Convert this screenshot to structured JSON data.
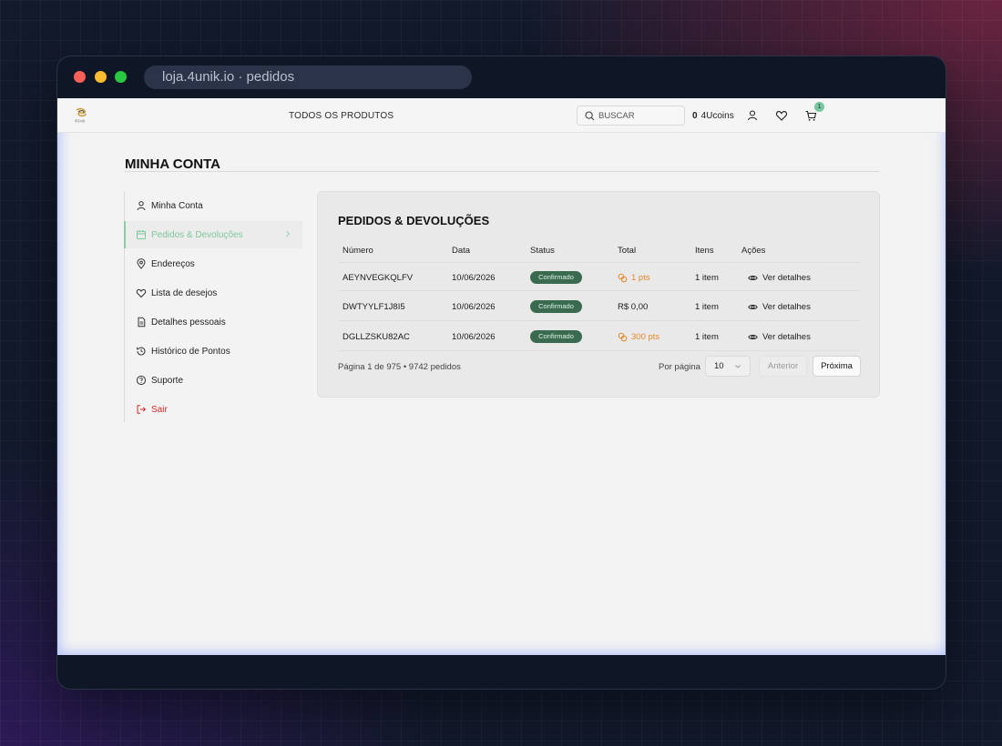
{
  "browser": {
    "url": "loja.4unik.io · pedidos"
  },
  "topnav": {
    "logo_text": "4Unik",
    "all_products": "TODOS OS PRODUTOS",
    "search_placeholder": "BUSCAR",
    "coins_value": "0",
    "coins_label": "4Ucoins",
    "cart_count": "1"
  },
  "page": {
    "title": "MINHA CONTA"
  },
  "sidebar": {
    "items": [
      {
        "label": "Minha Conta",
        "icon": "user-icon"
      },
      {
        "label": "Pedidos & Devoluções",
        "icon": "calendar-icon",
        "active": true
      },
      {
        "label": "Endereços",
        "icon": "map-pin-icon"
      },
      {
        "label": "Lista de desejos",
        "icon": "heart-icon"
      },
      {
        "label": "Detalhes pessoais",
        "icon": "document-icon"
      },
      {
        "label": "Histórico de Pontos",
        "icon": "history-icon"
      },
      {
        "label": "Suporte",
        "icon": "help-icon"
      },
      {
        "label": "Sair",
        "icon": "logout-icon"
      }
    ]
  },
  "orders": {
    "title": "PEDIDOS & DEVOLUÇÕES",
    "columns": [
      "Número",
      "Data",
      "Status",
      "Total",
      "Itens",
      "Ações"
    ],
    "rows": [
      {
        "number": "AEYNVEGKQLFV",
        "date": "10/06/2026",
        "status": "Confirmado",
        "total": "1 pts",
        "total_is_points": true,
        "items": "1 item",
        "action": "Ver detalhes"
      },
      {
        "number": "DWTYYLF1J8I5",
        "date": "10/06/2026",
        "status": "Confirmado",
        "total": "R$ 0,00",
        "total_is_points": false,
        "items": "1 item",
        "action": "Ver detalhes"
      },
      {
        "number": "DGLLZSKU82AC",
        "date": "10/06/2026",
        "status": "Confirmado",
        "total": "300 pts",
        "total_is_points": true,
        "items": "1 item",
        "action": "Ver detalhes"
      }
    ],
    "pagination": {
      "summary": "Página 1 de 975 • 9742 pedidos",
      "per_page_label": "Por página",
      "per_page_value": "10",
      "prev_label": "Anterior",
      "next_label": "Próxima"
    }
  },
  "colors": {
    "accent_green": "#88d0a4",
    "status_badge": "#3a6b50",
    "points_orange": "#e4892a",
    "logout_red": "#d42b2b"
  }
}
